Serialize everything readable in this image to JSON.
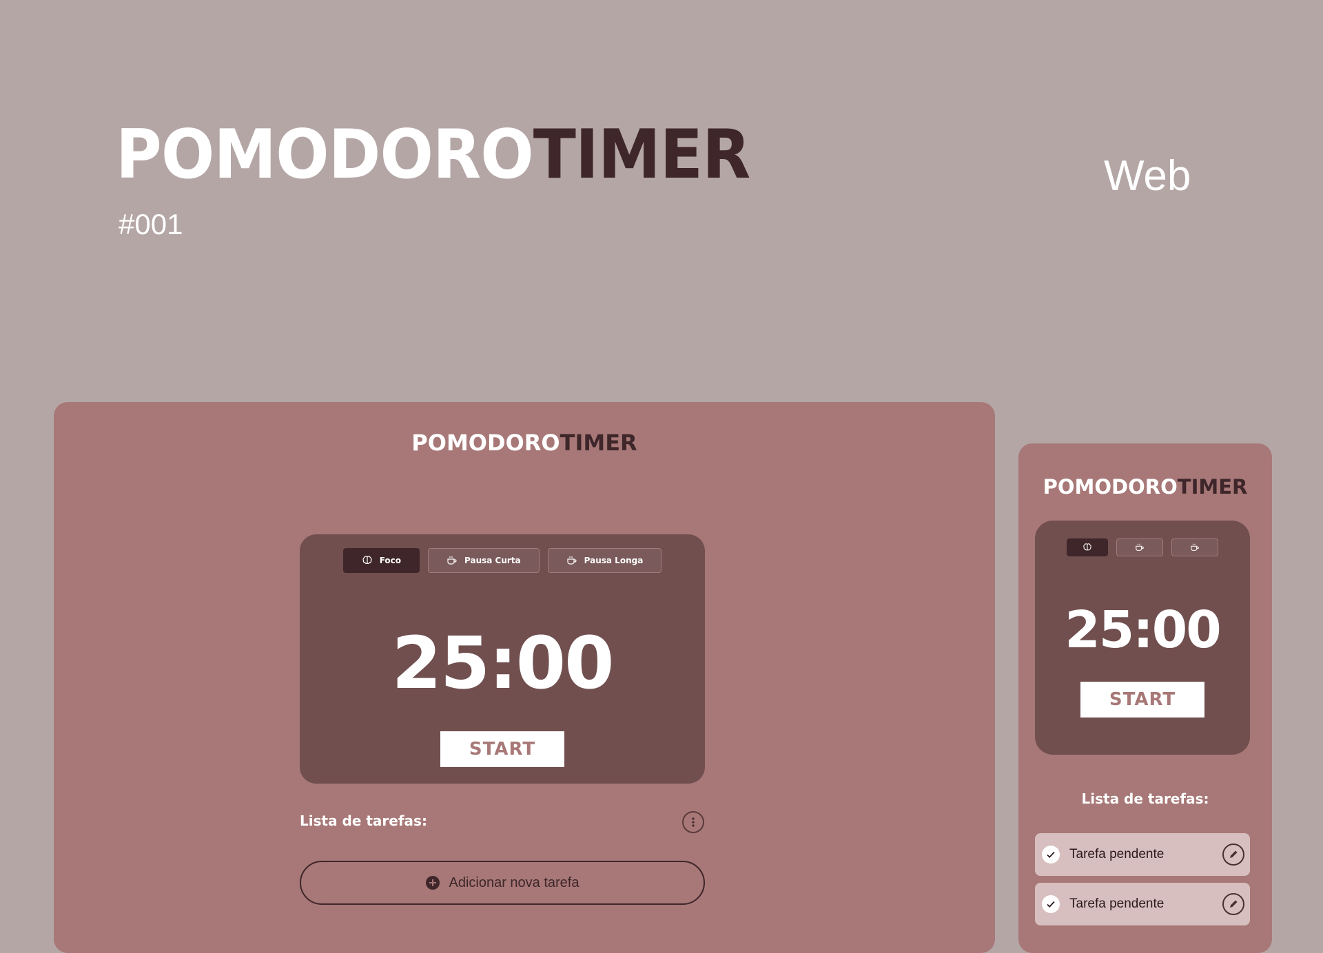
{
  "colors": {
    "page_bg": "#b5a6a6",
    "frame_bg": "#a77877",
    "card_bg": "#714f4f",
    "dark_accent": "#3e262a",
    "task_bg": "#d8bfbf"
  },
  "hero": {
    "title_light": "POMODORO",
    "title_dark": "TIMER",
    "number": "#001",
    "platform": "Web"
  },
  "desktop": {
    "logo_light": "POMODORO",
    "logo_dark": "TIMER",
    "tabs": [
      {
        "label": "Foco",
        "icon": "brain-icon",
        "active": true
      },
      {
        "label": "Pausa Curta",
        "icon": "coffee-icon",
        "active": false
      },
      {
        "label": "Pausa Longa",
        "icon": "coffee-icon",
        "active": false
      }
    ],
    "time": "25:00",
    "start_label": "START",
    "tasks_title": "Lista de tarefas:",
    "add_task_label": "Adicionar nova tarefa"
  },
  "mobile": {
    "logo_light": "POMODORO",
    "logo_dark": "TIMER",
    "tabs": [
      {
        "icon": "brain-icon",
        "active": true
      },
      {
        "icon": "coffee-icon",
        "active": false
      },
      {
        "icon": "coffee-icon",
        "active": false
      }
    ],
    "time": "25:00",
    "start_label": "START",
    "tasks_title": "Lista de tarefas:",
    "tasks": [
      {
        "label": "Tarefa pendente"
      },
      {
        "label": "Tarefa pendente"
      }
    ]
  }
}
